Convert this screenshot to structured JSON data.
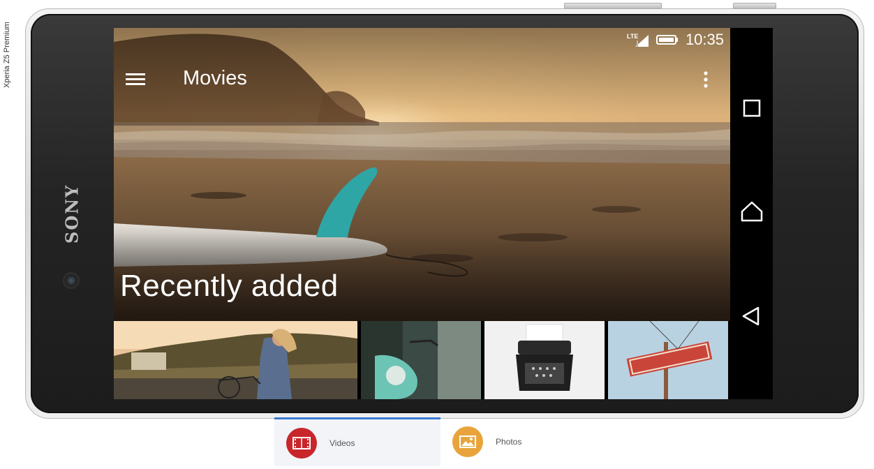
{
  "device": {
    "model_label": "Xperia Z5 Premium",
    "brand": "SONY"
  },
  "status_bar": {
    "network": "LTE",
    "time": "10:35"
  },
  "app_bar": {
    "title": "Movies",
    "menu_icon": "hamburger-menu-icon",
    "overflow_icon": "more-vert-icon"
  },
  "hero": {
    "section_title": "Recently added"
  },
  "nav_buttons": [
    "recent-apps-icon",
    "home-icon",
    "back-icon"
  ],
  "thumbnails": [
    {
      "name": "thumbnail-girl-on-bike"
    },
    {
      "name": "thumbnail-scooter"
    },
    {
      "name": "thumbnail-typewriter"
    },
    {
      "name": "thumbnail-motel-sign"
    }
  ],
  "tabs": [
    {
      "label": "Videos",
      "icon": "film-icon",
      "color": "#c8262b",
      "selected": true
    },
    {
      "label": "Photos",
      "icon": "image-icon",
      "color": "#e8a43b",
      "selected": false
    }
  ]
}
